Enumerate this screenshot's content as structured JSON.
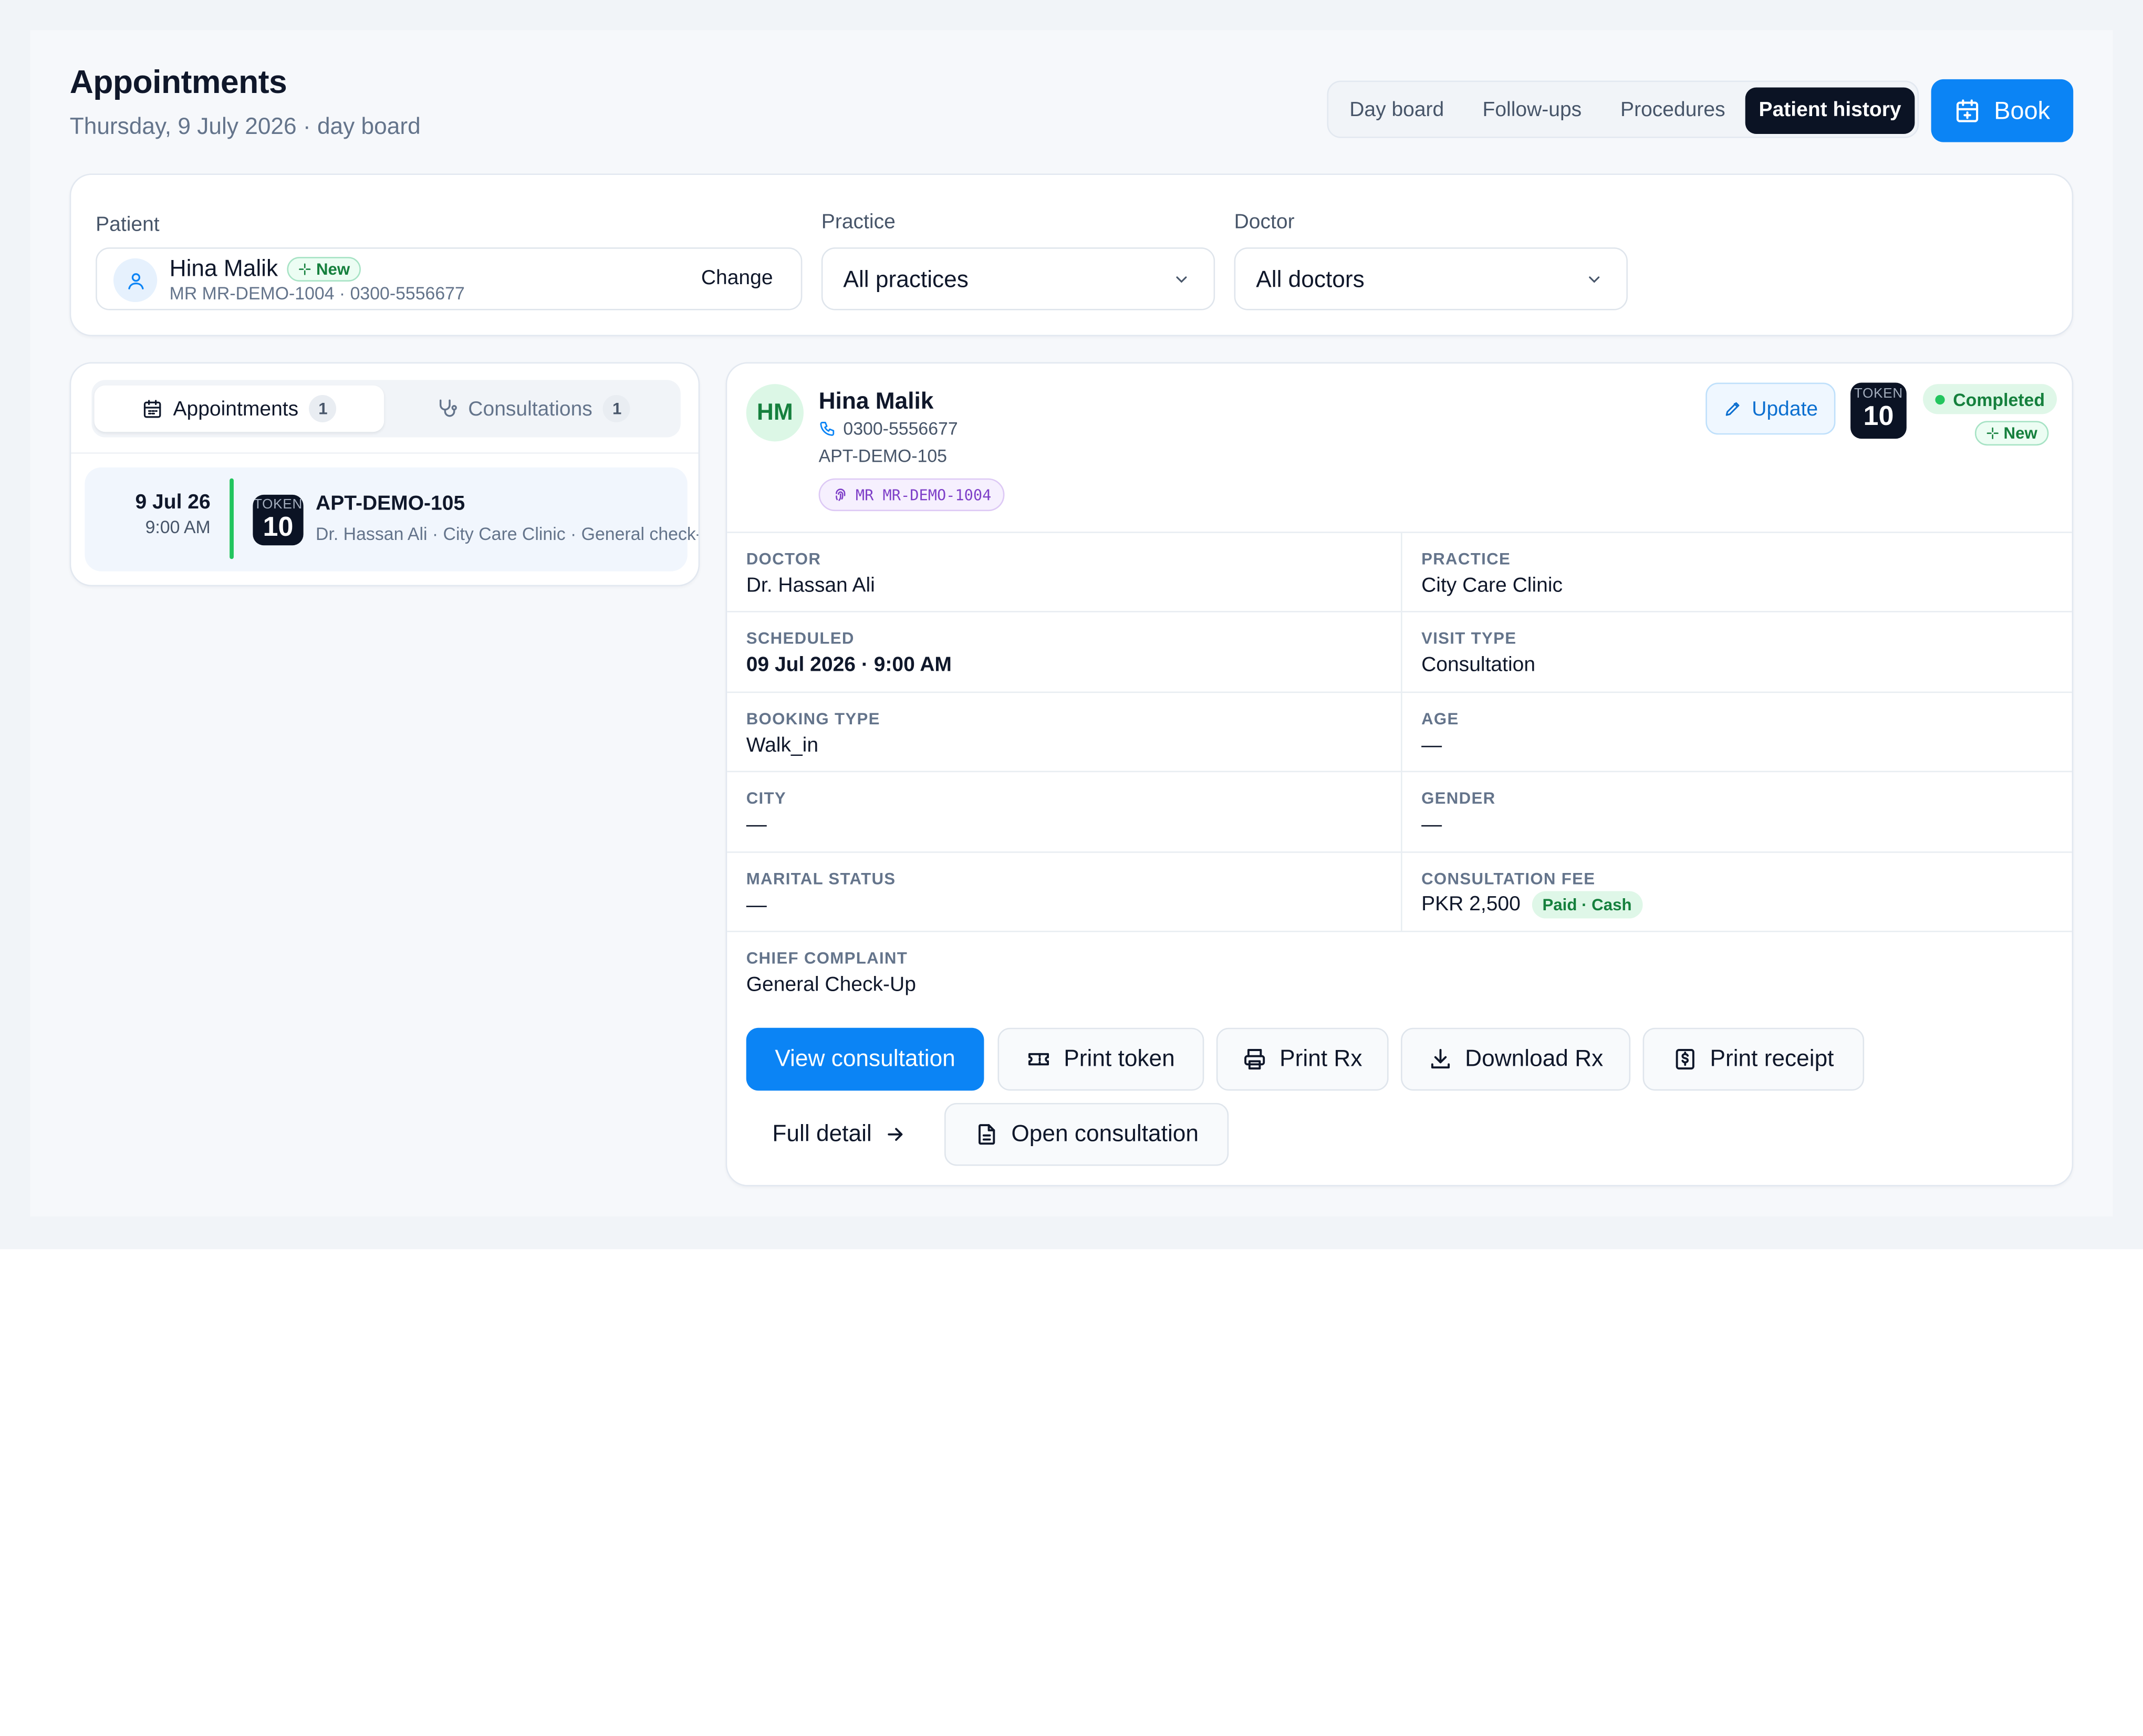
{
  "page": {
    "title": "Appointments",
    "subtitle": "Thursday, 9 July 2026 · day board"
  },
  "view_tabs": [
    {
      "label": "Day board",
      "active": false
    },
    {
      "label": "Follow-ups",
      "active": false
    },
    {
      "label": "Procedures",
      "active": false
    },
    {
      "label": "Patient history",
      "active": true
    }
  ],
  "book_button": {
    "label": "Book",
    "icon": "calendar-plus-icon"
  },
  "filters": {
    "patient_label": "Patient",
    "patient": {
      "name": "Hina Malik",
      "badge": "New",
      "meta": "MR MR-DEMO-1004 · 0300-5556677",
      "change_label": "Change"
    },
    "practice_label": "Practice",
    "practice_value": "All practices",
    "doctor_label": "Doctor",
    "doctor_value": "All doctors"
  },
  "history_tabs": [
    {
      "label": "Appointments",
      "count": "1",
      "active": true,
      "icon": "calendar-icon"
    },
    {
      "label": "Consultations",
      "count": "1",
      "active": false,
      "icon": "stethoscope-icon"
    }
  ],
  "history_items": [
    {
      "date": "9 Jul 26",
      "time": "9:00 AM",
      "token_label": "TOKEN",
      "token_number": "10",
      "id": "APT-DEMO-105",
      "detail": "Dr. Hassan Ali · City Care Clinic · General check-up"
    }
  ],
  "detail": {
    "initials": "HM",
    "name": "Hina Malik",
    "phone": "0300-5556677",
    "appointment_id": "APT-DEMO-105",
    "mr_badge": "MR MR-DEMO-1004",
    "update_label": "Update",
    "token_label": "TOKEN",
    "token_number": "10",
    "status": "Completed",
    "badge": "New",
    "fields": {
      "doctor": {
        "label": "DOCTOR",
        "value": "Dr. Hassan Ali"
      },
      "practice": {
        "label": "PRACTICE",
        "value": "City Care Clinic"
      },
      "scheduled": {
        "label": "SCHEDULED",
        "value": "09 Jul 2026 · 9:00 AM"
      },
      "visit_type": {
        "label": "VISIT TYPE",
        "value": "Consultation"
      },
      "booking_type": {
        "label": "BOOKING TYPE",
        "value": "Walk_in"
      },
      "age": {
        "label": "AGE",
        "value": "—"
      },
      "city": {
        "label": "CITY",
        "value": "—"
      },
      "gender": {
        "label": "GENDER",
        "value": "—"
      },
      "marital_status": {
        "label": "MARITAL STATUS",
        "value": "—"
      },
      "consultation_fee": {
        "label": "CONSULTATION FEE",
        "value": "PKR 2,500",
        "payment": "Paid · Cash"
      },
      "chief_complaint": {
        "label": "CHIEF COMPLAINT",
        "value": "General Check-Up"
      }
    },
    "actions": {
      "view_consultation": "View consultation",
      "print_token": "Print token",
      "print_rx": "Print Rx",
      "download_rx": "Download Rx",
      "print_receipt": "Print receipt",
      "full_detail": "Full detail",
      "open_consultation": "Open consultation"
    }
  },
  "colors": {
    "primary": "#0b84f5",
    "dark": "#0b1324",
    "success": "#22c55e",
    "success_text": "#15803d",
    "mr_badge": "#7e3fc8"
  }
}
